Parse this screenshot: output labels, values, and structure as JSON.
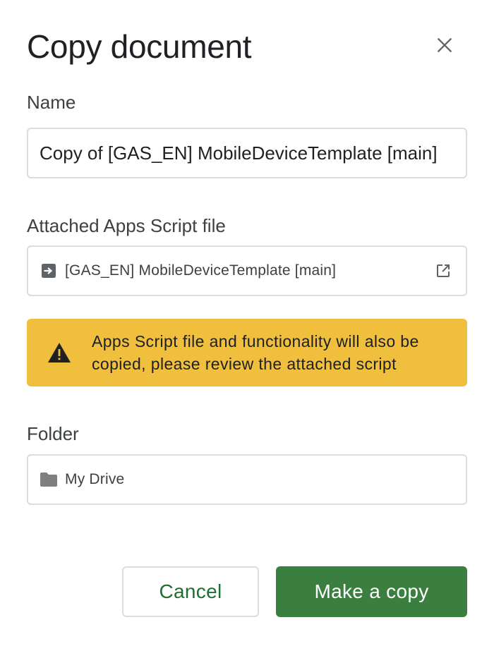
{
  "dialog": {
    "title": "Copy document",
    "close_icon": "close-icon"
  },
  "name_section": {
    "label": "Name",
    "value": "Copy of [GAS_EN] MobileDeviceTemplate [main]"
  },
  "script_section": {
    "label": "Attached Apps Script file",
    "file_name": "[GAS_EN] MobileDeviceTemplate [main]",
    "file_icon": "apps-script-icon",
    "open_icon": "open-in-new-icon"
  },
  "warning": {
    "icon": "warning-icon",
    "text_line1": "Apps Script file and functionality will also be",
    "text_line2": "copied, please review the attached script",
    "color": "#f0bf3d"
  },
  "folder_section": {
    "label": "Folder",
    "folder_name": "My Drive",
    "folder_icon": "folder-icon"
  },
  "actions": {
    "cancel_label": "Cancel",
    "confirm_label": "Make a copy",
    "confirm_color": "#3a7f3f",
    "cancel_text_color": "#1e6e32"
  }
}
